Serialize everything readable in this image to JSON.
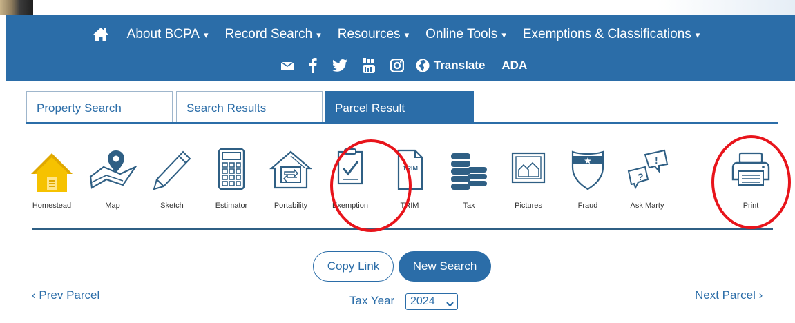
{
  "nav": {
    "items": [
      {
        "label": "About BCPA"
      },
      {
        "label": "Record Search"
      },
      {
        "label": "Resources"
      },
      {
        "label": "Online Tools"
      },
      {
        "label": "Exemptions & Classifications"
      }
    ],
    "caret": "▾",
    "translate_label": "Translate",
    "ada_label": "ADA"
  },
  "tabs": [
    {
      "label": "Property Search"
    },
    {
      "label": "Search Results"
    },
    {
      "label": "Parcel Result"
    }
  ],
  "tools": [
    {
      "label": "Homestead",
      "icon": "house-icon"
    },
    {
      "label": "Map",
      "icon": "map-pin-icon"
    },
    {
      "label": "Sketch",
      "icon": "pencil-icon"
    },
    {
      "label": "Estimator",
      "icon": "calculator-icon"
    },
    {
      "label": "Portability",
      "icon": "house-arrows-icon"
    },
    {
      "label": "Exemption",
      "icon": "clipboard-check-icon"
    },
    {
      "label": "TRIM",
      "icon": "trim-document-icon"
    },
    {
      "label": "Tax",
      "icon": "coin-stack-icon"
    },
    {
      "label": "Pictures",
      "icon": "picture-house-icon"
    },
    {
      "label": "Fraud",
      "icon": "shield-icon"
    },
    {
      "label": "Ask Marty",
      "icon": "speech-bubbles-icon"
    },
    {
      "label": "Print",
      "icon": "printer-icon"
    }
  ],
  "trim_text": "TRIM",
  "actions": {
    "copy_link": "Copy Link",
    "new_search": "New Search",
    "prev_parcel": "Prev Parcel",
    "next_parcel": "Next Parcel",
    "tax_year_label": "Tax Year",
    "tax_year_value": "2024"
  },
  "colors": {
    "nav_bg": "#2b6da8",
    "icon_blue": "#2f5f84",
    "homestead_yellow": "#f6c200",
    "annotation_red": "#e8141b"
  }
}
